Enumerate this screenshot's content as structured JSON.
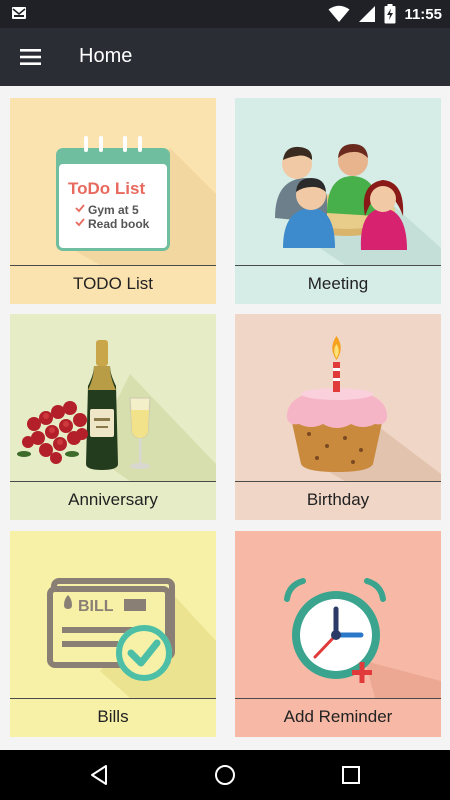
{
  "status_bar": {
    "time": "11:55",
    "icons": [
      "mail-notification-icon",
      "wifi-icon",
      "signal-icon",
      "battery-charging-icon"
    ]
  },
  "app_bar": {
    "title": "Home",
    "menu_icon": "hamburger-menu-icon"
  },
  "calendar_illustration": {
    "heading": "ToDo List",
    "items": [
      "Gym at 5",
      "Read book"
    ]
  },
  "bill_illustration": {
    "text": "BILL"
  },
  "cards": [
    {
      "label": "TODO List",
      "background": "#fbe3b0",
      "icon": "todo-calendar-icon"
    },
    {
      "label": "Meeting",
      "background": "#d6ece7",
      "icon": "meeting-people-icon"
    },
    {
      "label": "Anniversary",
      "background": "#e6ecc6",
      "icon": "champagne-roses-icon"
    },
    {
      "label": "Birthday",
      "background": "#f0d6c6",
      "icon": "birthday-cupcake-icon"
    },
    {
      "label": "Bills",
      "background": "#f7f1a8",
      "icon": "bill-paid-icon"
    },
    {
      "label": "Add Reminder",
      "background": "#f7b9a5",
      "icon": "alarm-clock-add-icon"
    }
  ],
  "nav_bar": {
    "buttons": [
      "back-icon",
      "home-icon",
      "recents-icon"
    ]
  }
}
